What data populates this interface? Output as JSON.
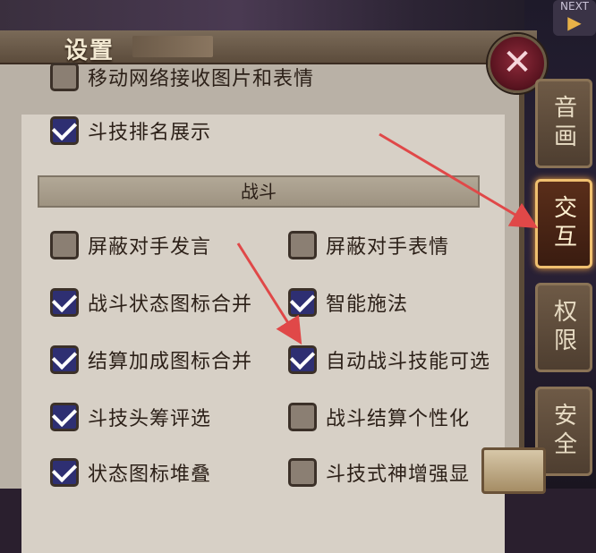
{
  "app": {
    "title": "设置"
  },
  "window": {
    "next_label": "NEXT"
  },
  "settings": {
    "top_items": [
      {
        "label": "移动网络接收图片和表情",
        "checked": false
      },
      {
        "label": "斗技排名展示",
        "checked": true
      }
    ],
    "section_title": "战斗",
    "battle_left": [
      {
        "label": "屏蔽对手发言",
        "checked": false
      },
      {
        "label": "战斗状态图标合并",
        "checked": true
      },
      {
        "label": "结算加成图标合并",
        "checked": true
      },
      {
        "label": "斗技头筹评选",
        "checked": true
      },
      {
        "label": "状态图标堆叠",
        "checked": true
      }
    ],
    "battle_right": [
      {
        "label": "屏蔽对手表情",
        "checked": false
      },
      {
        "label": "智能施法",
        "checked": true
      },
      {
        "label": "自动战斗技能可选",
        "checked": true
      },
      {
        "label": "战斗结算个性化",
        "checked": false
      },
      {
        "label": "斗技式神增强显",
        "checked": false
      }
    ]
  },
  "tabs": [
    {
      "label": "音画",
      "active": false
    },
    {
      "label": "交互",
      "active": true
    },
    {
      "label": "权限",
      "active": false
    },
    {
      "label": "安全",
      "active": false
    }
  ],
  "colors": {
    "arrow": "#e04848",
    "checkbox_on": "#2e2f72",
    "tab_active_border": "#f0c070"
  }
}
